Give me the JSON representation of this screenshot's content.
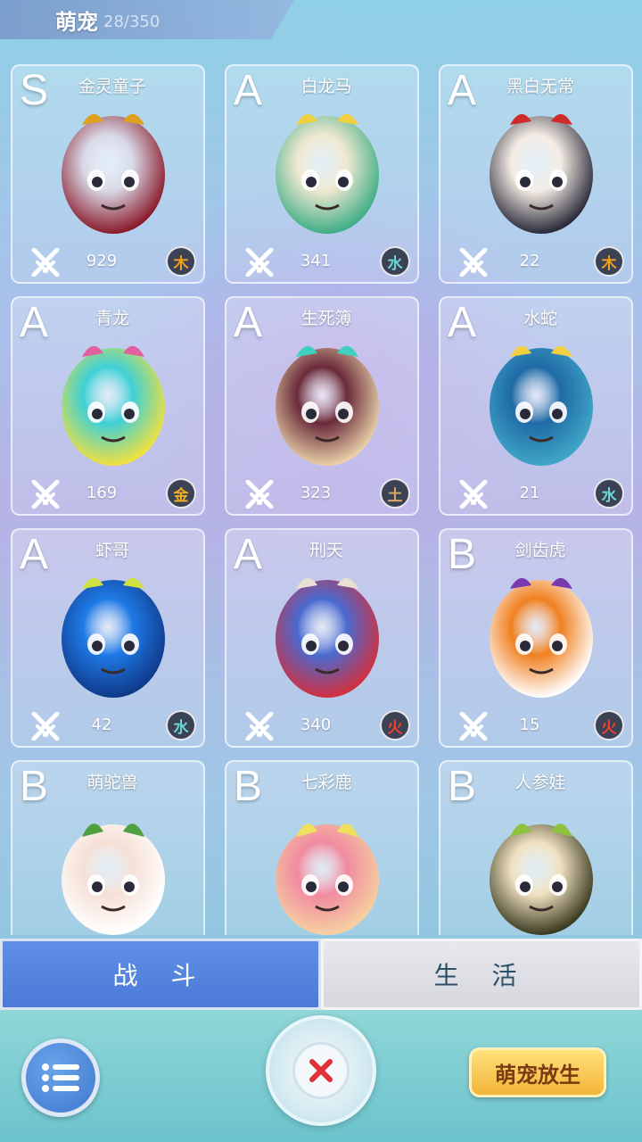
{
  "header": {
    "title": "萌宠",
    "count": "28/350"
  },
  "pets": [
    {
      "grade": "S",
      "name": "金灵童子",
      "power": "929",
      "element": "木",
      "element_color": "#f0a020",
      "palette": [
        "#d8d8e6",
        "#8a1a2a",
        "#e0a020"
      ],
      "icon": "golden-spirit-child-icon"
    },
    {
      "grade": "A",
      "name": "白龙马",
      "power": "341",
      "element": "水",
      "element_color": "#6fd6d6",
      "palette": [
        "#efe8d0",
        "#3fae86",
        "#f0d040"
      ],
      "icon": "white-dragon-horse-icon"
    },
    {
      "grade": "A",
      "name": "黑白无常",
      "power": "22",
      "element": "木",
      "element_color": "#f0a020",
      "palette": [
        "#f4ece4",
        "#2a2a3a",
        "#d02a2a"
      ],
      "icon": "black-white-impermanence-icon"
    },
    {
      "grade": "A",
      "name": "青龙",
      "power": "169",
      "element": "金",
      "element_color": "#f0b020",
      "palette": [
        "#3fd0d6",
        "#f0e040",
        "#e060a0"
      ],
      "icon": "azure-dragon-icon"
    },
    {
      "grade": "A",
      "name": "生死簿",
      "power": "323",
      "element": "土",
      "element_color": "#d8a868",
      "palette": [
        "#6a2a3a",
        "#e8d0a8",
        "#3fd0c0"
      ],
      "icon": "book-of-life-death-icon"
    },
    {
      "grade": "A",
      "name": "水蛇",
      "power": "21",
      "element": "水",
      "element_color": "#6fd6d6",
      "palette": [
        "#1f6aa6",
        "#3fa6c6",
        "#f0d040"
      ],
      "icon": "water-snake-icon"
    },
    {
      "grade": "A",
      "name": "虾哥",
      "power": "42",
      "element": "水",
      "element_color": "#6fd6d6",
      "palette": [
        "#1f7ae6",
        "#0f3a8a",
        "#d0e040"
      ],
      "icon": "shrimp-bro-icon"
    },
    {
      "grade": "A",
      "name": "刑天",
      "power": "340",
      "element": "火",
      "element_color": "#f04030",
      "palette": [
        "#4a6ad0",
        "#d03040",
        "#e8e0d0"
      ],
      "icon": "xingtian-icon"
    },
    {
      "grade": "B",
      "name": "剑齿虎",
      "power": "15",
      "element": "火",
      "element_color": "#f04030",
      "palette": [
        "#f08020",
        "#ffffff",
        "#7a3ab0"
      ],
      "icon": "sabertooth-tiger-icon"
    },
    {
      "grade": "B",
      "name": "萌驼兽",
      "power": "",
      "element": "",
      "element_color": "#ffffff",
      "palette": [
        "#f6e0d6",
        "#ffffff",
        "#50a040"
      ],
      "icon": "cute-camel-icon"
    },
    {
      "grade": "B",
      "name": "七彩鹿",
      "power": "",
      "element": "",
      "element_color": "#ffffff",
      "palette": [
        "#f08aa0",
        "#f6d0a0",
        "#f0e060"
      ],
      "icon": "rainbow-deer-icon"
    },
    {
      "grade": "B",
      "name": "人参娃",
      "power": "",
      "element": "",
      "element_color": "#ffffff",
      "palette": [
        "#efe0c0",
        "#3a3a20",
        "#90c040"
      ],
      "icon": "ginseng-baby-icon"
    }
  ],
  "tabs": {
    "battle": "战 斗",
    "life": "生 活"
  },
  "bottom": {
    "release_label": "萌宠放生"
  },
  "icons": {
    "menu": "list-icon",
    "close": "close-icon",
    "power": "crossed-swords-icon"
  }
}
